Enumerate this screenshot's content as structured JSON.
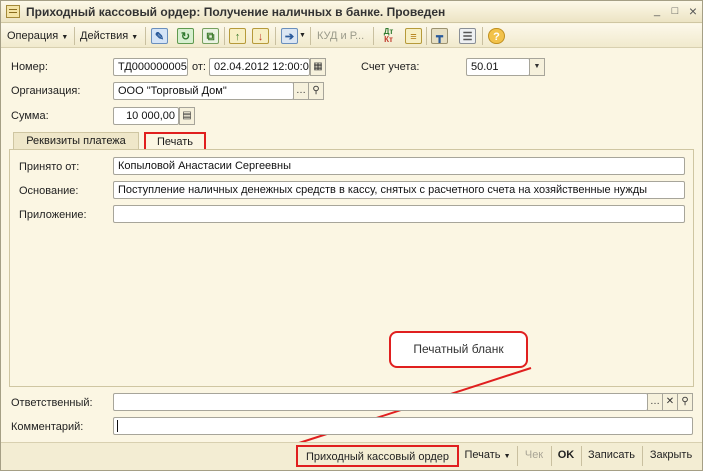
{
  "window": {
    "title": "Приходный кассовый ордер: Получение наличных в банке. Проведен",
    "minimize": "_",
    "maximize": "□",
    "close": "×"
  },
  "toolbar": {
    "operation": "Операция",
    "actions": "Действия",
    "kud": "КУД и Р...",
    "dt_kt_top": "Дт",
    "dt_kt_bottom": "Кт",
    "help": "?"
  },
  "header": {
    "number_label": "Номер:",
    "number_value": "ТД000000005",
    "from_label": "от:",
    "date_value": "02.04.2012 12:00:00",
    "account_label": "Счет учета:",
    "account_value": "50.01",
    "org_label": "Организация:",
    "org_value": "ООО \"Торговый Дом\"",
    "sum_label": "Сумма:",
    "sum_value": "10 000,00"
  },
  "tabs": [
    {
      "label": "Реквизиты платежа"
    },
    {
      "label": "Печать"
    }
  ],
  "print_tab": {
    "received_label": "Принято от:",
    "received_value": "Копыловой Анастасии Сергеевны",
    "basis_label": "Основание:",
    "basis_value": "Поступление наличных денежных средств в кассу, снятых с расчетного счета на хозяйственные нужды",
    "attachment_label": "Приложение:",
    "attachment_value": ""
  },
  "callout": {
    "text": "Печатный бланк"
  },
  "footer": {
    "responsible_label": "Ответственный:",
    "responsible_value": "",
    "comment_label": "Комментарий:",
    "comment_value": ""
  },
  "bottom_buttons": {
    "print_form": "Приходный кассовый ордер",
    "print": "Печать",
    "check": "Чек",
    "ok": "OK",
    "save": "Записать",
    "close": "Закрыть"
  },
  "colors": {
    "highlight": "#e01f1f",
    "background": "#fbf6e3"
  }
}
